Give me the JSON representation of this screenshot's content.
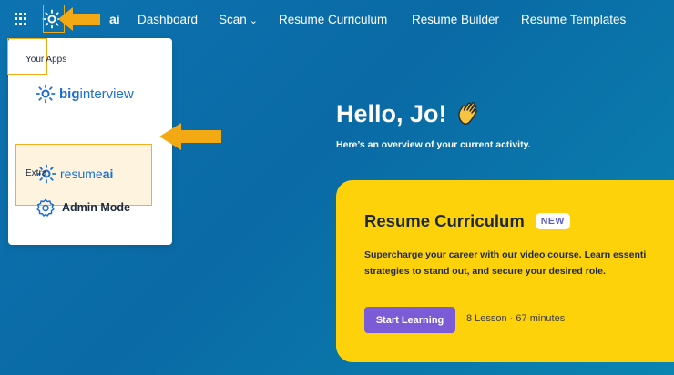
{
  "topnav": {
    "logo_text": "ai",
    "items": [
      {
        "label": "Dashboard"
      },
      {
        "label": "Scan",
        "has_dropdown": true
      },
      {
        "label": "Resume Curriculum"
      },
      {
        "label": "Resume Builder"
      },
      {
        "label": "Resume Templates"
      }
    ]
  },
  "dropdown": {
    "your_apps_label": "Your Apps",
    "apps": [
      {
        "name_bold": "big",
        "name_rest": "interview",
        "brand": "biginterview"
      },
      {
        "name_rest": "resume",
        "name_bold": "ai",
        "brand": "resumeai",
        "active": true
      }
    ],
    "extra_label": "Extra",
    "admin_label": "Admin Mode"
  },
  "main": {
    "greeting": "Hello, Jo!",
    "subtitle": "Here’s an overview of your current activity."
  },
  "card": {
    "title": "Resume Curriculum",
    "badge": "NEW",
    "desc_line1": "Supercharge your career with our video course. Learn essenti",
    "desc_line2": "strategies to stand out, and secure your desired role.",
    "button_label": "Start Learning",
    "meta": "8 Lesson · 67 minutes"
  },
  "colors": {
    "brand_blue": "#1a6fd6",
    "card_yellow": "#fdd20a",
    "button_purple": "#7b5bd6",
    "highlight_orange": "#f3a913"
  },
  "icons": [
    "grid-icon",
    "sun-logo-icon",
    "chevron-down-icon",
    "waving-hand-icon",
    "gear-icon",
    "arrow-left-icon"
  ]
}
